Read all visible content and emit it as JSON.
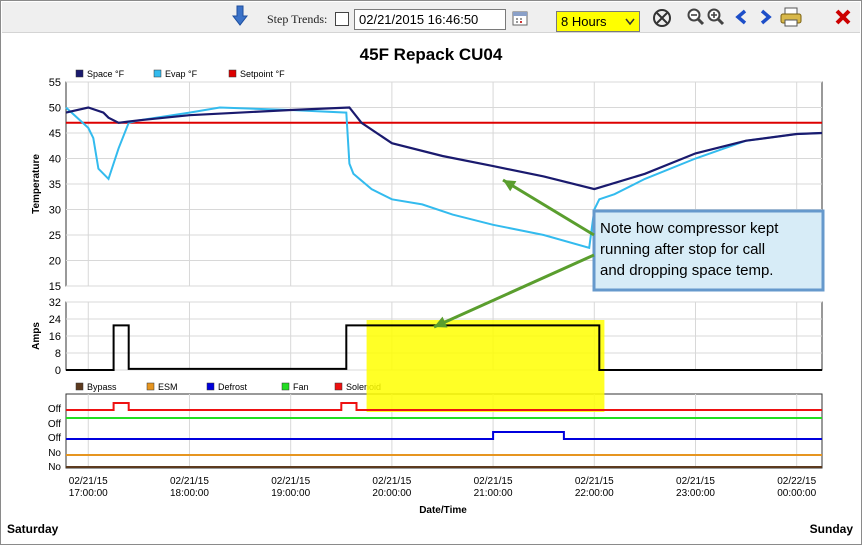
{
  "toolbar": {
    "step_trends_label": "Step Trends:",
    "step_trends_checked": false,
    "datetime_value": "02/21/2015 16:46:50",
    "range_value": "8 Hours",
    "range_options": [
      "8 Hours"
    ],
    "icons": [
      "download-arrow-icon",
      "calendar-icon",
      "reset-zoom-icon",
      "zoom-out-icon",
      "zoom-in-icon",
      "previous-icon",
      "next-icon",
      "print-icon",
      "close-icon"
    ]
  },
  "footer": {
    "left_day": "Saturday",
    "right_day": "Sunday"
  },
  "colors": {
    "space": "#1a1a6e",
    "evap": "#33bbee",
    "setpoint": "#dd0000",
    "bypass": "#5c3a1e",
    "esm": "#e69520",
    "defrost": "#0000dd",
    "fan": "#22dd22",
    "solenoid": "#ee1111",
    "highlight": "#ffff00",
    "callout_bg": "#d7ecf7",
    "callout_border": "#6699cc",
    "arrow": "#5a9e2e"
  },
  "annotation": {
    "text_lines": [
      "Note how compressor kept",
      "running after stop for call",
      "and dropping space temp."
    ]
  },
  "chart_data": {
    "title": "45F Repack CU04",
    "x_axis": {
      "label": "Date/Time",
      "tick_dates": [
        "02/21/15",
        "02/21/15",
        "02/21/15",
        "02/21/15",
        "02/21/15",
        "02/21/15",
        "02/21/15",
        "02/22/15"
      ],
      "tick_times": [
        "17:00:00",
        "18:00:00",
        "19:00:00",
        "20:00:00",
        "21:00:00",
        "22:00:00",
        "23:00:00",
        "00:00:00"
      ]
    },
    "temperature": {
      "type": "line",
      "ylabel": "Temperature",
      "ylim": [
        15,
        55
      ],
      "yticks": [
        15,
        20,
        25,
        30,
        35,
        40,
        45,
        50,
        55
      ],
      "legend": [
        "Space °F",
        "Evap °F",
        "Setpoint °F"
      ],
      "series": [
        {
          "name": "Space °F",
          "color": "space",
          "x": [
            16.78,
            17.0,
            17.15,
            17.2,
            17.3,
            17.5,
            18.0,
            19.0,
            19.58,
            19.7,
            20.0,
            20.5,
            21.0,
            21.5,
            22.0,
            22.5,
            23.0,
            23.5,
            24.0,
            24.25
          ],
          "values": [
            49,
            50,
            49,
            48,
            47,
            47.5,
            48.5,
            49.5,
            50,
            47,
            43,
            40.5,
            38.5,
            36.5,
            34,
            37,
            41,
            43.5,
            44.8,
            45
          ]
        },
        {
          "name": "Evap °F",
          "color": "evap",
          "x": [
            16.78,
            17.0,
            17.05,
            17.1,
            17.2,
            17.3,
            17.4,
            17.5,
            18.0,
            18.3,
            19.0,
            19.55,
            19.58,
            19.62,
            19.8,
            20.0,
            20.3,
            20.6,
            21.0,
            21.5,
            21.95,
            22.0,
            22.05,
            22.2,
            22.5,
            23.0,
            23.5,
            24.0,
            24.25
          ],
          "values": [
            50,
            46,
            44,
            38,
            36,
            42,
            47,
            47.5,
            49,
            50,
            49.5,
            49,
            39,
            37,
            34,
            32,
            31,
            29,
            27,
            25,
            22.5,
            30,
            32,
            33,
            36,
            40,
            43.5,
            44.8,
            45
          ]
        },
        {
          "name": "Setpoint °F",
          "color": "setpoint",
          "x": [
            16.78,
            24.25
          ],
          "values": [
            47,
            47
          ]
        }
      ]
    },
    "amps": {
      "type": "line",
      "ylabel": "Amps",
      "ylim": [
        0,
        32
      ],
      "yticks": [
        0,
        8,
        16,
        24,
        32
      ],
      "series": [
        {
          "name": "Amps",
          "x": [
            16.78,
            17.25,
            17.25,
            17.4,
            17.4,
            19.55,
            19.55,
            22.05,
            22.05,
            24.25
          ],
          "values": [
            0,
            0,
            21,
            21,
            0.5,
            0.5,
            21,
            21,
            0,
            0
          ]
        }
      ],
      "highlight_x": [
        19.75,
        22.1
      ]
    },
    "digital": {
      "type": "step",
      "legend": [
        "Bypass",
        "ESM",
        "Defrost",
        "Fan",
        "Solenoid"
      ],
      "row_labels": [
        "Off",
        "Off",
        "Off",
        "No",
        "No"
      ],
      "series": [
        {
          "name": "Solenoid",
          "color": "solenoid",
          "on_intervals": [
            [
              17.25,
              17.4
            ],
            [
              19.5,
              19.65
            ]
          ]
        },
        {
          "name": "Fan",
          "color": "fan",
          "on_intervals": []
        },
        {
          "name": "Defrost",
          "color": "defrost",
          "on_intervals": [
            [
              21.0,
              21.7
            ]
          ]
        },
        {
          "name": "ESM",
          "color": "esm",
          "on_intervals": []
        },
        {
          "name": "Bypass",
          "color": "bypass",
          "on_intervals": []
        }
      ]
    }
  }
}
